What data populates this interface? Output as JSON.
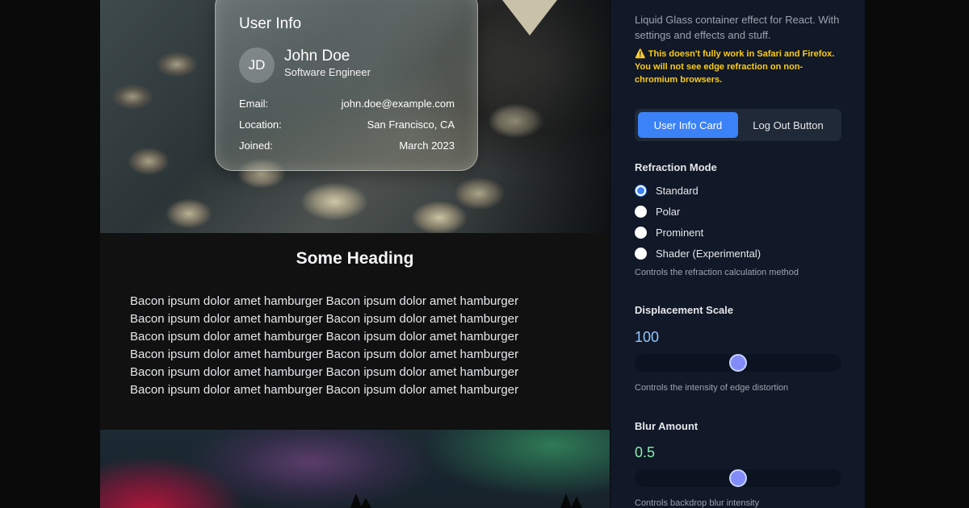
{
  "card": {
    "title": "User Info",
    "initials": "JD",
    "name": "John Doe",
    "role": "Software Engineer",
    "rows": [
      {
        "label": "Email:",
        "value": "john.doe@example.com"
      },
      {
        "label": "Location:",
        "value": "San Francisco, CA"
      },
      {
        "label": "Joined:",
        "value": "March 2023"
      }
    ]
  },
  "content": {
    "heading": "Some Heading",
    "lines": [
      "Bacon ipsum dolor amet hamburger Bacon ipsum dolor amet hamburger",
      "Bacon ipsum dolor amet hamburger Bacon ipsum dolor amet hamburger",
      "Bacon ipsum dolor amet hamburger Bacon ipsum dolor amet hamburger",
      "Bacon ipsum dolor amet hamburger Bacon ipsum dolor amet hamburger",
      "Bacon ipsum dolor amet hamburger Bacon ipsum dolor amet hamburger",
      "Bacon ipsum dolor amet hamburger Bacon ipsum dolor amet hamburger"
    ]
  },
  "panel": {
    "description": "Liquid Glass container effect for React. With settings and effects and stuff.",
    "warning": "⚠️ This doesn't fully work in Safari and Firefox. You will not see edge refraction on non-chromium browsers.",
    "tabs": [
      {
        "label": "User Info Card",
        "active": true
      },
      {
        "label": "Log Out Button",
        "active": false
      }
    ],
    "refraction": {
      "title": "Refraction Mode",
      "options": [
        "Standard",
        "Polar",
        "Prominent",
        "Shader (Experimental)"
      ],
      "selected": "Standard",
      "hint": "Controls the refraction calculation method"
    },
    "displacement": {
      "title": "Displacement Scale",
      "value": "100",
      "level": 0.5,
      "hint": "Controls the intensity of edge distortion"
    },
    "blur": {
      "title": "Blur Amount",
      "value": "0.5",
      "level": 0.5,
      "hint": "Controls backdrop blur intensity"
    }
  },
  "colors": {
    "accent": "#3b82f6",
    "warning": "#facc15",
    "displacement_value": "#93c5fd",
    "blur_value": "#86efac",
    "slider_thumb": "#818cf8"
  }
}
